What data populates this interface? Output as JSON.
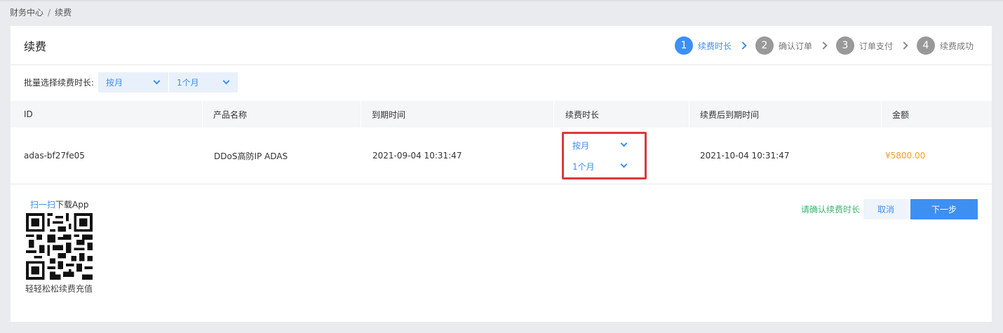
{
  "breadcrumb": {
    "parent": "财务中心",
    "separator": "/",
    "current": "续费"
  },
  "panel": {
    "title": "续费"
  },
  "steps": [
    {
      "num": "1",
      "label": "续费时长",
      "active": true
    },
    {
      "num": "2",
      "label": "确认订单",
      "active": false
    },
    {
      "num": "3",
      "label": "订单支付",
      "active": false
    },
    {
      "num": "4",
      "label": "续费成功",
      "active": false
    }
  ],
  "batch": {
    "label": "批量选择续费时长:",
    "unit_value": "按月",
    "duration_value": "1个月"
  },
  "table": {
    "headers": [
      "ID",
      "产品名称",
      "到期时间",
      "续费时长",
      "续费后到期时间",
      "金额"
    ],
    "rows": [
      {
        "id": "adas-bf27fe05",
        "product": "DDoS高防IP ADAS",
        "expire": "2021-09-04 10:31:47",
        "unit": "按月",
        "duration": "1个月",
        "new_expire": "2021-10-04 10:31:47",
        "amount": "¥5800.00"
      }
    ]
  },
  "app": {
    "scan_link": "扫一扫",
    "scan_rest": "下载App",
    "caption": "轻轻松松续费充值"
  },
  "footer": {
    "confirm_text": "请确认续费时长",
    "cancel_label": "取消",
    "next_label": "下一步"
  },
  "colors": {
    "accent": "#3d8ff2",
    "amount": "#f0a020",
    "confirm": "#3cb371",
    "highlight_border": "#d93a3a"
  }
}
